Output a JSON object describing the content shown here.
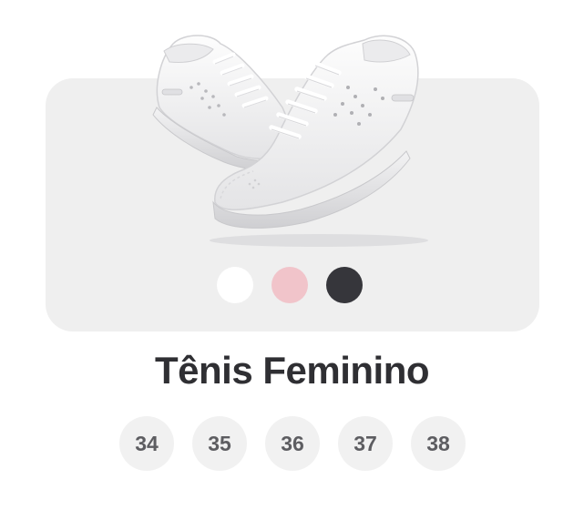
{
  "product": {
    "title": "Tênis Feminino",
    "image_icon": "white-sneakers-pair"
  },
  "colors": [
    {
      "name": "white",
      "hex": "#ffffff"
    },
    {
      "name": "pink",
      "hex": "#f1c4ca"
    },
    {
      "name": "dark-gray",
      "hex": "#36363b"
    }
  ],
  "sizes": [
    "34",
    "35",
    "36",
    "37",
    "38"
  ]
}
